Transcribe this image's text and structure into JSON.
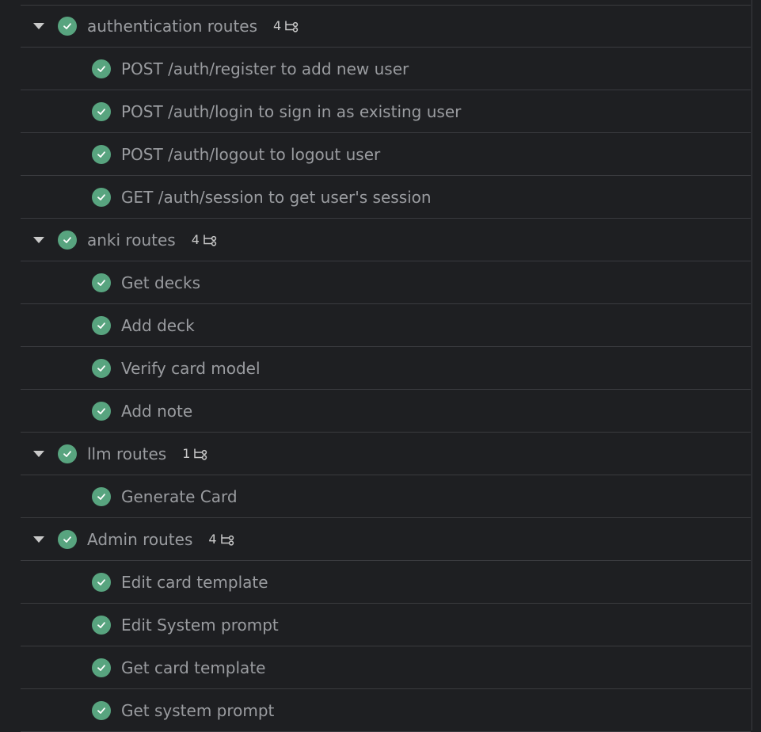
{
  "groups": [
    {
      "label": "authentication routes",
      "count": "4",
      "items": [
        "POST /auth/register to add new user",
        "POST /auth/login to sign in as existing user",
        "POST /auth/logout to logout user",
        "GET /auth/session to get user's session"
      ]
    },
    {
      "label": "anki routes",
      "count": "4",
      "items": [
        "Get decks",
        "Add deck",
        "Verify card model",
        "Add note"
      ]
    },
    {
      "label": "llm routes",
      "count": "1",
      "items": [
        "Generate Card"
      ]
    },
    {
      "label": "Admin routes",
      "count": "4",
      "items": [
        "Edit card template",
        "Edit System prompt",
        "Get card template",
        "Get system prompt"
      ]
    }
  ],
  "colors": {
    "background": "#1e1f22",
    "check_green": "#58a47f",
    "text": "#9a9ca0",
    "divider": "#3a3b3f"
  },
  "icons": {
    "caret": "caret-down-icon",
    "check": "check-circle-icon",
    "subtasks": "subtask-branch-icon"
  }
}
